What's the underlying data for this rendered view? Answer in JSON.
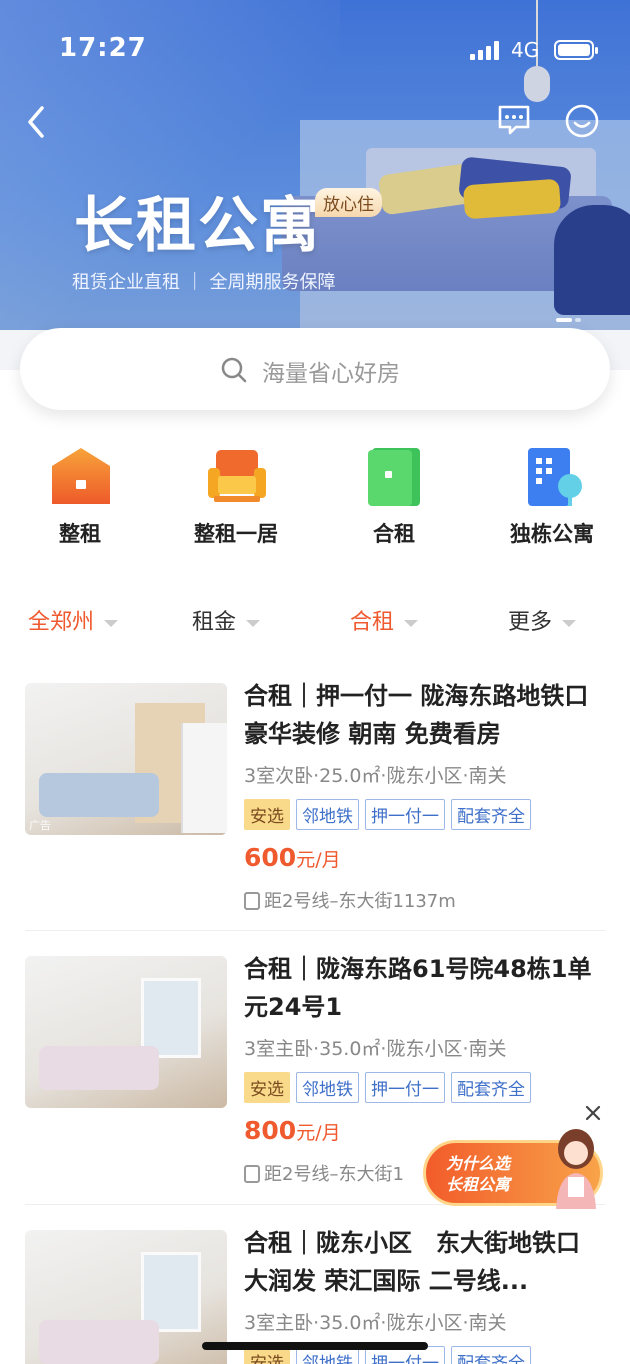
{
  "status_bar": {
    "time": "17:27",
    "network": "4G"
  },
  "hero": {
    "title": "长租公寓",
    "tag": "放心住",
    "subtitle": "租赁企业直租 ｜ 全周期服务保障"
  },
  "search": {
    "placeholder": "海量省心好房"
  },
  "categories": [
    {
      "label": "整租",
      "icon": "house-icon"
    },
    {
      "label": "整租一居",
      "icon": "sofa-icon"
    },
    {
      "label": "合租",
      "icon": "door-icon"
    },
    {
      "label": "独栋公寓",
      "icon": "building-icon"
    }
  ],
  "filters": [
    {
      "label": "全郑州",
      "active": true
    },
    {
      "label": "租金",
      "active": false
    },
    {
      "label": "合租",
      "active": true
    },
    {
      "label": "更多",
      "active": false
    }
  ],
  "listings": [
    {
      "title": "合租｜押一付一 陇海东路地铁口 豪华装修 朝南 免费看房",
      "meta": "3室次卧·25.0㎡·陇东小区·南关",
      "tags": [
        "安选",
        "邻地铁",
        "押一付一",
        "配套齐全"
      ],
      "price": "600",
      "price_unit": "元/月",
      "distance": "距2号线–东大街1137m",
      "ad_label": "广告"
    },
    {
      "title": "合租｜陇海东路61号院48栋1单元24号1",
      "meta": "3室主卧·35.0㎡·陇东小区·南关",
      "tags": [
        "安选",
        "邻地铁",
        "押一付一",
        "配套齐全"
      ],
      "price": "800",
      "price_unit": "元/月",
      "distance": "距2号线–东大街1"
    },
    {
      "title": "合租｜陇东小区　东大街地铁口 大润发 荣汇国际 二号线...",
      "meta": "3室主卧·35.0㎡·陇东小区·南关",
      "tags": [
        "安选",
        "邻地铁",
        "押一付一",
        "配套齐全"
      ]
    }
  ],
  "promo": {
    "line1": "为什么选",
    "line2": "长租公寓"
  },
  "colors": {
    "accent": "#ef5a2f",
    "brand_blue": "#3f72d6",
    "tag_blue": "#3e6fc9"
  }
}
